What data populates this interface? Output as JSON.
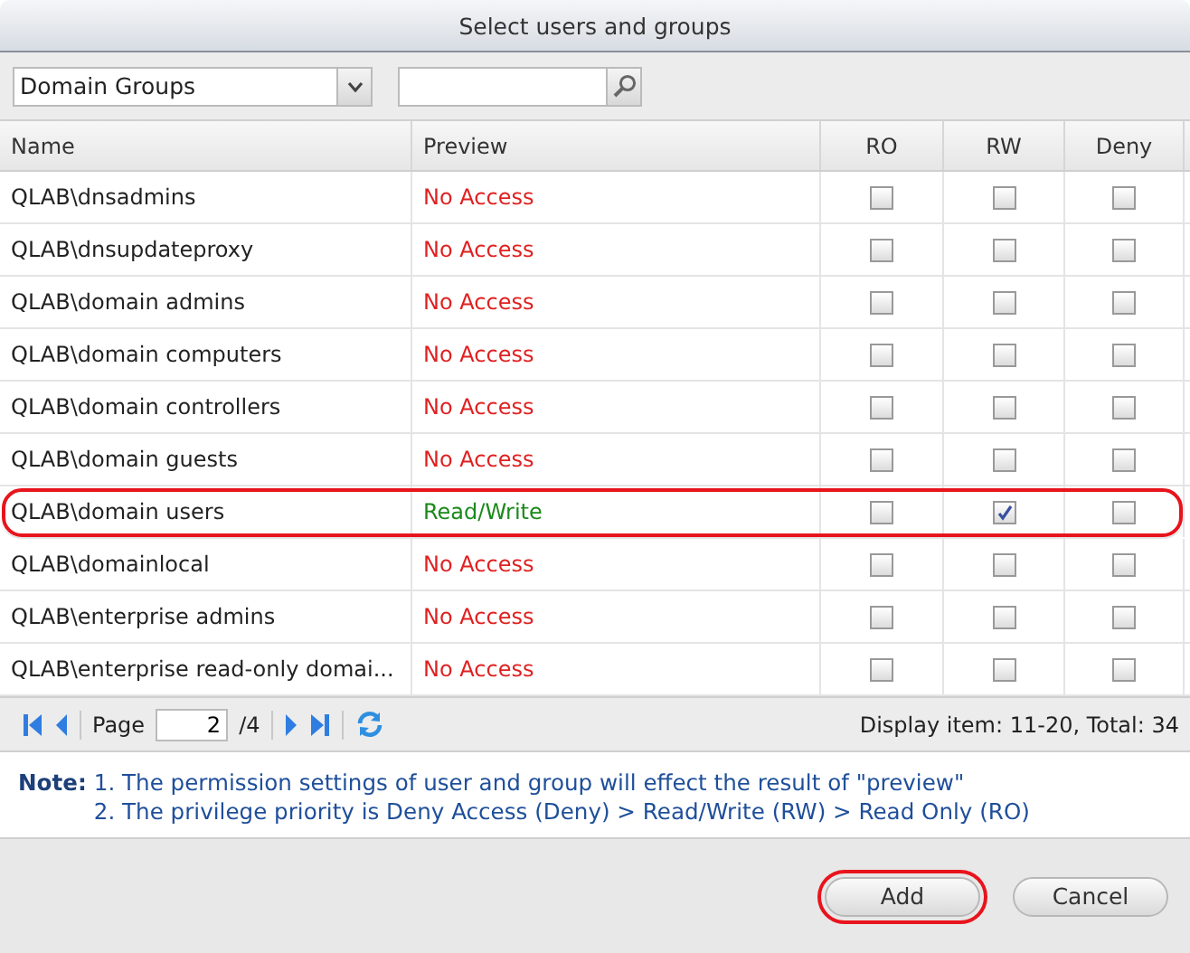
{
  "window": {
    "title": "Select users and groups"
  },
  "filter": {
    "value": "Domain Groups"
  },
  "table": {
    "columns": [
      "Name",
      "Preview",
      "RO",
      "RW",
      "Deny"
    ],
    "rows": [
      {
        "name": "QLAB\\dnsadmins",
        "preview": "No Access",
        "color": "#e02020",
        "ro": false,
        "rw": false,
        "deny": false,
        "highlighted": false
      },
      {
        "name": "QLAB\\dnsupdateproxy",
        "preview": "No Access",
        "color": "#e02020",
        "ro": false,
        "rw": false,
        "deny": false,
        "highlighted": false
      },
      {
        "name": "QLAB\\domain admins",
        "preview": "No Access",
        "color": "#e02020",
        "ro": false,
        "rw": false,
        "deny": false,
        "highlighted": false
      },
      {
        "name": "QLAB\\domain computers",
        "preview": "No Access",
        "color": "#e02020",
        "ro": false,
        "rw": false,
        "deny": false,
        "highlighted": false
      },
      {
        "name": "QLAB\\domain controllers",
        "preview": "No Access",
        "color": "#e02020",
        "ro": false,
        "rw": false,
        "deny": false,
        "highlighted": false
      },
      {
        "name": "QLAB\\domain guests",
        "preview": "No Access",
        "color": "#e02020",
        "ro": false,
        "rw": false,
        "deny": false,
        "highlighted": false
      },
      {
        "name": "QLAB\\domain users",
        "preview": "Read/Write",
        "color": "#1a8a1a",
        "ro": false,
        "rw": true,
        "deny": false,
        "highlighted": true
      },
      {
        "name": "QLAB\\domainlocal",
        "preview": "No Access",
        "color": "#e02020",
        "ro": false,
        "rw": false,
        "deny": false,
        "highlighted": false
      },
      {
        "name": "QLAB\\enterprise admins",
        "preview": "No Access",
        "color": "#e02020",
        "ro": false,
        "rw": false,
        "deny": false,
        "highlighted": false
      },
      {
        "name": "QLAB\\enterprise read-only domai...",
        "preview": "No Access",
        "color": "#e02020",
        "ro": false,
        "rw": false,
        "deny": false,
        "highlighted": false
      }
    ]
  },
  "pager": {
    "label": "Page",
    "page": "2",
    "total": "/4",
    "display": "Display item: 11-20, Total: 34"
  },
  "note": {
    "label": "Note:",
    "lines": [
      "1. The permission settings of user and group will effect the result of \"preview\"",
      "2. The privilege priority is Deny Access (Deny) > Read/Write (RW) > Read Only (RO)"
    ]
  },
  "buttons": [
    {
      "label": "Add",
      "highlighted": true
    },
    {
      "label": "Cancel",
      "highlighted": false
    }
  ]
}
